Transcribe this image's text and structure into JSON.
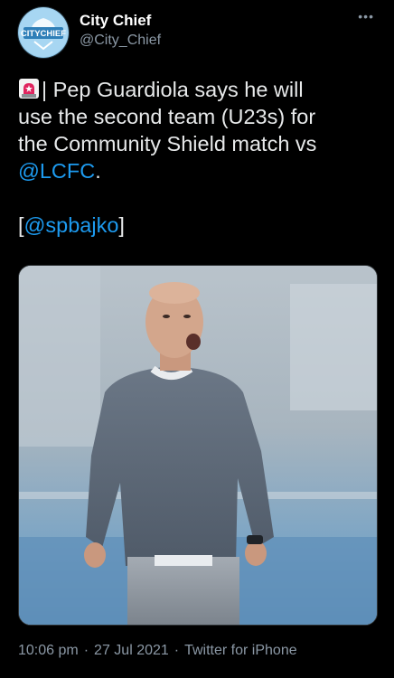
{
  "tweet": {
    "author": {
      "display_name": "City Chief",
      "handle": "@City_Chief",
      "avatar_label": "CITYCHIEF"
    },
    "more_icon": "more-dots-icon",
    "text": {
      "emoji": "police-car-light-icon",
      "line1_rest": "| Pep Guardiola says he will",
      "line2": "use the second team (U23s) for",
      "line3": "the Community Shield match vs",
      "mention": "@LCFC",
      "mention_suffix": ".",
      "source_open": "[",
      "source_mention": "@spbajko",
      "source_close": "]"
    },
    "media": {
      "type": "photo"
    },
    "meta": {
      "time": "10:06 pm",
      "separator": "·",
      "date": "27 Jul 2021",
      "client": "Twitter for iPhone"
    }
  },
  "colors": {
    "background": "#000000",
    "text": "#e7e9ea",
    "secondary": "#8b98a5",
    "link": "#1d9bf0"
  }
}
